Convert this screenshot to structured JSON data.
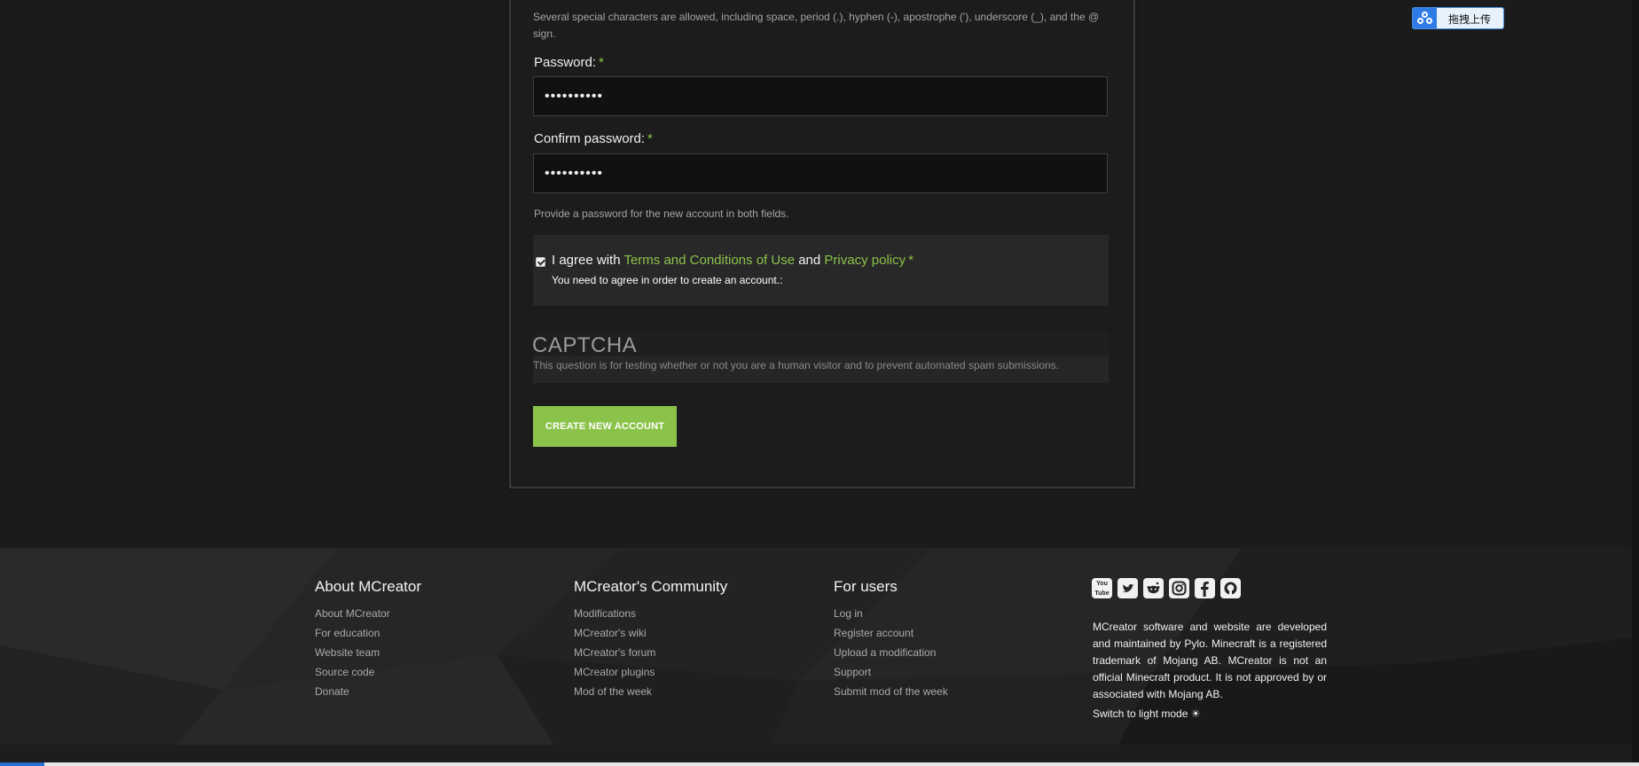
{
  "form": {
    "username_hint": "Several special characters are allowed, including space, period (.), hyphen (-), apostrophe ('), underscore (_), and the @ sign.",
    "password_label": "Password:",
    "password_value": "••••••••••",
    "confirm_label": "Confirm password:",
    "confirm_value": "••••••••••",
    "required_mark": "*",
    "password_hint": "Provide a password for the new account in both fields.",
    "agree_prefix": "I agree with",
    "terms_link": "Terms and Conditions of Use",
    "agree_and": "and",
    "privacy_link": "Privacy policy",
    "agree_note": "You need to agree in order to create an account.:",
    "agree_checked": true,
    "captcha_title": "CAPTCHA",
    "captcha_desc": "This question is for testing whether or not you are a human visitor and to prevent automated spam submissions.",
    "submit_label": "CREATE NEW ACCOUNT"
  },
  "upload_widget": {
    "label": "拖拽上传"
  },
  "footer": {
    "about": {
      "title": "About MCreator",
      "links": [
        "About MCreator",
        "For education",
        "Website team",
        "Source code",
        "Donate"
      ]
    },
    "community": {
      "title": "MCreator's Community",
      "links": [
        "Modifications",
        "MCreator's wiki",
        "MCreator's forum",
        "MCreator plugins",
        "Mod of the week"
      ]
    },
    "users": {
      "title": "For users",
      "links": [
        "Log in",
        "Register account",
        "Upload a modification",
        "Support",
        "Submit mod of the week"
      ]
    },
    "social_icons": [
      "youtube-icon",
      "twitter-icon",
      "reddit-icon",
      "instagram-icon",
      "facebook-icon",
      "github-icon"
    ],
    "about_text": "MCreator software and website are developed and maintained by Pylo. Minecraft is a registered trademark of Mojang AB. MCreator is not an official Minecraft product. It is not approved by or associated with Mojang AB.",
    "light_mode_label": "Switch to light mode ☀"
  },
  "colors": {
    "accent": "#8bc34a",
    "background": "#1b1b1b",
    "footer_bg": "#242424"
  }
}
